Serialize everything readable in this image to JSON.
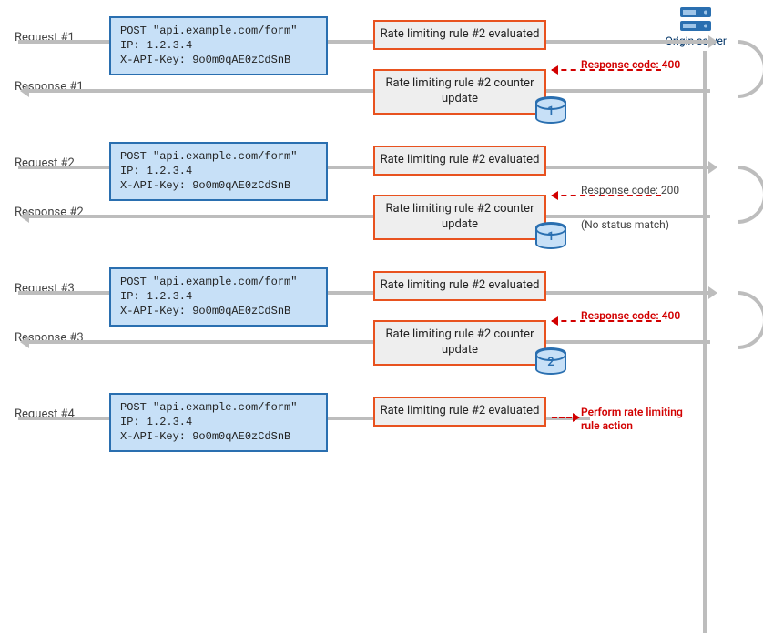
{
  "server_label": "Origin server",
  "packet": {
    "l1": "POST \"api.example.com/form\"",
    "l2": "IP: 1.2.3.4",
    "l3": "X-API-Key: 9o0m0qAE0zCdSnB"
  },
  "rule_eval": "Rate limiting rule #2 evaluated",
  "rule_upd": "Rate limiting rule #2 counter update",
  "labels": {
    "req1": "Request #1",
    "resp1": "Response #1",
    "req2": "Request #2",
    "resp2": "Response #2",
    "req3": "Request #3",
    "resp3": "Response #3",
    "req4": "Request #4"
  },
  "counters": {
    "after1": "1",
    "after2": "1",
    "after3": "2"
  },
  "notes": {
    "status": "Response code: 400",
    "nomatch": "(No status match)",
    "action": "Perform rate limiting rule action"
  }
}
